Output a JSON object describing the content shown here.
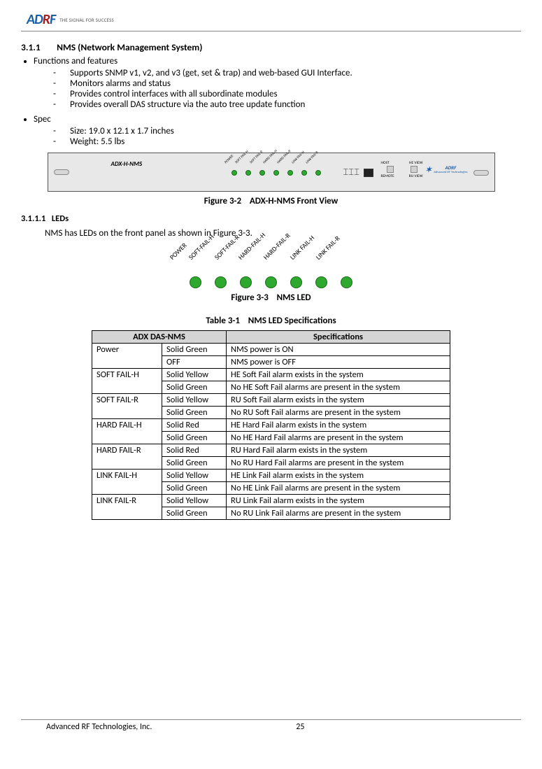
{
  "header": {
    "logo_text_ad": "AD",
    "logo_text_r": "R",
    "logo_text_f": "F",
    "tagline": "THE SIGNAL FOR SUCCESS"
  },
  "section": {
    "num": "3.1.1",
    "title": "NMS (Network Management System)"
  },
  "functions": {
    "heading": "Functions and features",
    "items": [
      "Supports SNMP v1, v2, and v3 (get, set & trap) and web-based GUI Interface.",
      "Monitors alarms and status",
      "Provides control interfaces with all subordinate modules",
      "Provides overall DAS structure via the auto tree update function"
    ]
  },
  "spec": {
    "heading": "Spec",
    "items": [
      "Size: 19.0 x 12.1 x 1.7 inches",
      "Weight: 5.5 lbs"
    ]
  },
  "panel": {
    "model": "ADX-H-NMS",
    "led_labels": [
      "POWER",
      "SOFT FAIL-H",
      "SOFT FAIL-R",
      "HARD FAIL-H",
      "HARD FAIL-R",
      "LINK FAIL-H",
      "LINK FAIL-R"
    ],
    "sw_top_left": "HOST",
    "sw_top_right": "HE VIEW",
    "sw_bot_left": "REMOTE",
    "sw_bot_right": "RU VIEW",
    "brand": "ADRF",
    "brand_sub": "Advanced RF Technologies"
  },
  "fig32": {
    "label": "Figure 3-2",
    "title": "ADX-H-NMS Front View"
  },
  "leds_section": {
    "num": "3.1.1.1",
    "title": "LEDs",
    "body": "NMS has LEDs on the front panel as shown in Figure 3-3."
  },
  "big_led_labels": [
    "POWER",
    "SOFT-FAIL-H",
    "SOFT-FAIL-R",
    "HARD-FAIL-H",
    "HARD-FAIL-R",
    "LINK FAIL-H",
    "LINK FAIL-R"
  ],
  "fig33": {
    "label": "Figure 3-3",
    "title": "NMS LED"
  },
  "table31": {
    "label": "Table 3-1",
    "title": "NMS LED Specifications"
  },
  "table": {
    "h1": "ADX DAS-NMS",
    "h2": "Specifications",
    "rows": [
      {
        "led": "Power",
        "state": "Solid Green",
        "desc": "NMS power is ON"
      },
      {
        "led": "",
        "state": "OFF",
        "desc": "NMS power is OFF"
      },
      {
        "led": "SOFT FAIL-H",
        "state": "Solid Yellow",
        "desc": "HE Soft Fail alarm exists in the system"
      },
      {
        "led": "",
        "state": "Solid Green",
        "desc": "No HE Soft Fail alarms are present in the system"
      },
      {
        "led": "SOFT FAIL-R",
        "state": "Solid Yellow",
        "desc": "RU Soft Fail alarm exists in the system"
      },
      {
        "led": "",
        "state": "Solid Green",
        "desc": "No RU Soft Fail alarms are present in the system"
      },
      {
        "led": "HARD FAIL-H",
        "state": "Solid Red",
        "desc": "HE Hard Fail alarm exists in the system"
      },
      {
        "led": "",
        "state": "Solid Green",
        "desc": "No HE Hard Fail alarms are present in the system"
      },
      {
        "led": "HARD FAIL-R",
        "state": "Solid Red",
        "desc": "RU Hard Fail alarm exists in the system"
      },
      {
        "led": "",
        "state": "Solid Green",
        "desc": "No RU Hard Fail alarms are present in the system"
      },
      {
        "led": "LINK FAIL-H",
        "state": "Solid Yellow",
        "desc": "HE Link Fail alarm exists in the system"
      },
      {
        "led": "",
        "state": "Solid Green",
        "desc": "No HE Link Fail alarms are present in the system"
      },
      {
        "led": "LINK FAIL-R",
        "state": "Solid Yellow",
        "desc": "RU Link Fail alarm exists in the system"
      },
      {
        "led": "",
        "state": "Solid Green",
        "desc": "No RU Link Fail alarms are present in the system"
      }
    ]
  },
  "footer": {
    "company": "Advanced RF Technologies, Inc.",
    "page": "25"
  }
}
